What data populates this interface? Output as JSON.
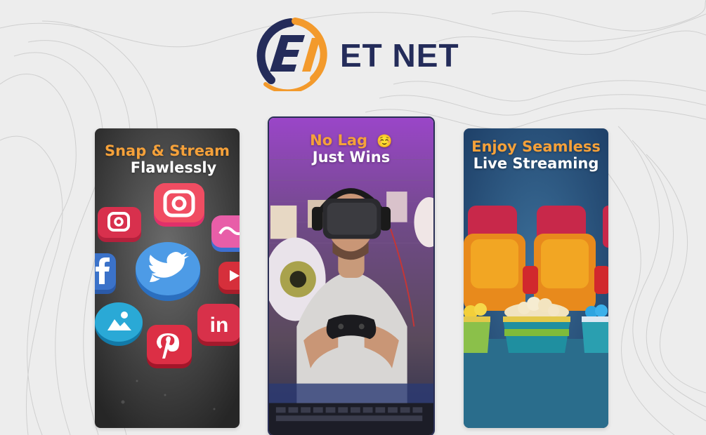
{
  "brand": {
    "name": "ET NET",
    "logo_letters": "ET",
    "colors": {
      "navy": "#242c5a",
      "orange": "#f5a13a"
    }
  },
  "cards": [
    {
      "headline": "Snap & Stream",
      "subline": "Flawlessly",
      "theme": "social-media-icons",
      "icons": [
        "instagram-icon",
        "twitter-icon",
        "facebook-icon",
        "linkedin-icon",
        "pinterest-icon",
        "youtube-icon",
        "maps-icon",
        "messenger-icon"
      ]
    },
    {
      "headline": "No Lag",
      "emoji": "☺️",
      "subline": "Just Wins",
      "theme": "vr-gamer"
    },
    {
      "headline": "Enjoy Seamless",
      "subline": "Live Streaming",
      "theme": "cinema-seats-popcorn"
    }
  ]
}
